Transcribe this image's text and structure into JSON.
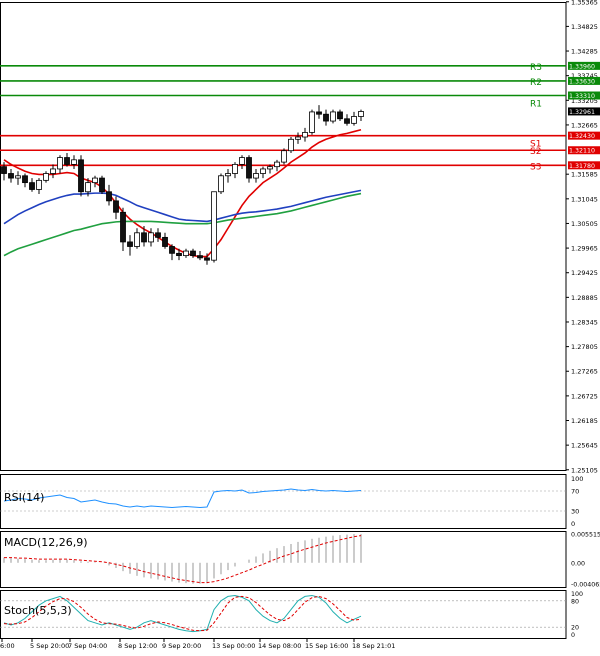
{
  "chart_data": {
    "type": "candlestick",
    "title": "",
    "price_axis": {
      "ylim": [
        1.251,
        1.3536
      ],
      "ticks": [
        "1.35365",
        "1.34825",
        "1.34285",
        "1.33745",
        "1.33205",
        "1.32665",
        "1.31585",
        "1.31045",
        "1.30505",
        "1.29965",
        "1.29425",
        "1.28885",
        "1.28345",
        "1.27805",
        "1.27265",
        "1.26725",
        "1.26185",
        "1.25645",
        "1.25105"
      ]
    },
    "x_axis": {
      "tick_labels": [
        "6:00",
        "5 Sep 20:00",
        "7 Sep 04:00",
        "8 Sep 12:00",
        "9 Sep 20:00",
        "13 Sep 00:00",
        "14 Sep 08:00",
        "15 Sep 16:00",
        "18 Sep 21:01"
      ]
    },
    "current_price": {
      "label": "1.32961",
      "value": 1.32961
    },
    "levels": [
      {
        "name": "R3",
        "value": 1.3396,
        "label": "1.33960",
        "color": "#0a8a0a"
      },
      {
        "name": "R2",
        "value": 1.3363,
        "label": "1.33630",
        "color": "#0a8a0a"
      },
      {
        "name": "R1",
        "value": 1.3331,
        "label": "1.33310",
        "color": "#0a8a0a"
      },
      {
        "name": "S1",
        "value": 1.3243,
        "label": "1.32430",
        "color": "#e00000"
      },
      {
        "name": "S2",
        "value": 1.3211,
        "label": "1.32110",
        "color": "#e00000"
      },
      {
        "name": "S3",
        "value": 1.3178,
        "label": "1.31780",
        "color": "#e00000"
      }
    ],
    "candles": [
      {
        "o": 1.3175,
        "h": 1.3185,
        "l": 1.3145,
        "c": 1.316
      },
      {
        "o": 1.316,
        "h": 1.317,
        "l": 1.314,
        "c": 1.315
      },
      {
        "o": 1.315,
        "h": 1.3165,
        "l": 1.3135,
        "c": 1.3155
      },
      {
        "o": 1.3155,
        "h": 1.316,
        "l": 1.313,
        "c": 1.314
      },
      {
        "o": 1.314,
        "h": 1.315,
        "l": 1.312,
        "c": 1.3125
      },
      {
        "o": 1.3125,
        "h": 1.315,
        "l": 1.3115,
        "c": 1.3145
      },
      {
        "o": 1.3145,
        "h": 1.3165,
        "l": 1.314,
        "c": 1.316
      },
      {
        "o": 1.316,
        "h": 1.318,
        "l": 1.315,
        "c": 1.317
      },
      {
        "o": 1.317,
        "h": 1.32,
        "l": 1.316,
        "c": 1.3195
      },
      {
        "o": 1.3195,
        "h": 1.3205,
        "l": 1.3175,
        "c": 1.318
      },
      {
        "o": 1.318,
        "h": 1.32,
        "l": 1.317,
        "c": 1.319
      },
      {
        "o": 1.319,
        "h": 1.32,
        "l": 1.311,
        "c": 1.312
      },
      {
        "o": 1.312,
        "h": 1.315,
        "l": 1.311,
        "c": 1.314
      },
      {
        "o": 1.314,
        "h": 1.3155,
        "l": 1.313,
        "c": 1.315
      },
      {
        "o": 1.315,
        "h": 1.3155,
        "l": 1.3115,
        "c": 1.312
      },
      {
        "o": 1.312,
        "h": 1.3135,
        "l": 1.309,
        "c": 1.31
      },
      {
        "o": 1.31,
        "h": 1.311,
        "l": 1.306,
        "c": 1.3075
      },
      {
        "o": 1.3075,
        "h": 1.3085,
        "l": 1.299,
        "c": 1.301
      },
      {
        "o": 1.301,
        "h": 1.3025,
        "l": 1.298,
        "c": 1.3
      },
      {
        "o": 1.3,
        "h": 1.304,
        "l": 1.2995,
        "c": 1.303
      },
      {
        "o": 1.303,
        "h": 1.3045,
        "l": 1.3,
        "c": 1.301
      },
      {
        "o": 1.301,
        "h": 1.304,
        "l": 1.3,
        "c": 1.303
      },
      {
        "o": 1.303,
        "h": 1.304,
        "l": 1.301,
        "c": 1.302
      },
      {
        "o": 1.302,
        "h": 1.303,
        "l": 1.2995,
        "c": 1.3
      },
      {
        "o": 1.3,
        "h": 1.3005,
        "l": 1.297,
        "c": 1.2985
      },
      {
        "o": 1.2985,
        "h": 1.2995,
        "l": 1.297,
        "c": 1.298
      },
      {
        "o": 1.298,
        "h": 1.2995,
        "l": 1.2975,
        "c": 1.299
      },
      {
        "o": 1.299,
        "h": 1.2995,
        "l": 1.2975,
        "c": 1.298
      },
      {
        "o": 1.298,
        "h": 1.299,
        "l": 1.297,
        "c": 1.2975
      },
      {
        "o": 1.2975,
        "h": 1.2985,
        "l": 1.296,
        "c": 1.297
      },
      {
        "o": 1.297,
        "h": 1.312,
        "l": 1.2965,
        "c": 1.312
      },
      {
        "o": 1.312,
        "h": 1.316,
        "l": 1.3115,
        "c": 1.3155
      },
      {
        "o": 1.3155,
        "h": 1.317,
        "l": 1.314,
        "c": 1.316
      },
      {
        "o": 1.316,
        "h": 1.3185,
        "l": 1.315,
        "c": 1.318
      },
      {
        "o": 1.318,
        "h": 1.32,
        "l": 1.317,
        "c": 1.3195
      },
      {
        "o": 1.3195,
        "h": 1.32,
        "l": 1.314,
        "c": 1.315
      },
      {
        "o": 1.315,
        "h": 1.317,
        "l": 1.314,
        "c": 1.316
      },
      {
        "o": 1.316,
        "h": 1.3175,
        "l": 1.315,
        "c": 1.317
      },
      {
        "o": 1.317,
        "h": 1.318,
        "l": 1.316,
        "c": 1.3175
      },
      {
        "o": 1.3175,
        "h": 1.319,
        "l": 1.3165,
        "c": 1.3185
      },
      {
        "o": 1.3185,
        "h": 1.3215,
        "l": 1.318,
        "c": 1.321
      },
      {
        "o": 1.321,
        "h": 1.324,
        "l": 1.3205,
        "c": 1.3235
      },
      {
        "o": 1.3235,
        "h": 1.325,
        "l": 1.3225,
        "c": 1.324
      },
      {
        "o": 1.324,
        "h": 1.326,
        "l": 1.323,
        "c": 1.325
      },
      {
        "o": 1.325,
        "h": 1.33,
        "l": 1.3245,
        "c": 1.3295
      },
      {
        "o": 1.3295,
        "h": 1.331,
        "l": 1.328,
        "c": 1.329
      },
      {
        "o": 1.329,
        "h": 1.33,
        "l": 1.3265,
        "c": 1.3275
      },
      {
        "o": 1.3275,
        "h": 1.33,
        "l": 1.327,
        "c": 1.3295
      },
      {
        "o": 1.3295,
        "h": 1.33,
        "l": 1.3275,
        "c": 1.328
      },
      {
        "o": 1.328,
        "h": 1.329,
        "l": 1.3265,
        "c": 1.327
      },
      {
        "o": 1.327,
        "h": 1.3295,
        "l": 1.3265,
        "c": 1.3285
      },
      {
        "o": 1.3285,
        "h": 1.33,
        "l": 1.3275,
        "c": 1.3296
      }
    ],
    "moving_averages": [
      {
        "color": "#e00000",
        "values": [
          1.319,
          1.318,
          1.3172,
          1.3165,
          1.316,
          1.3158,
          1.3158,
          1.3158,
          1.316,
          1.3162,
          1.316,
          1.315,
          1.3145,
          1.314,
          1.313,
          1.3115,
          1.3095,
          1.3075,
          1.306,
          1.3048,
          1.3038,
          1.303,
          1.302,
          1.301,
          1.3,
          1.2992,
          1.2985,
          1.298,
          1.2978,
          1.2978,
          1.2995,
          1.3015,
          1.304,
          1.3065,
          1.309,
          1.311,
          1.3125,
          1.314,
          1.315,
          1.316,
          1.3172,
          1.3185,
          1.3195,
          1.3205,
          1.3218,
          1.3228,
          1.3235,
          1.324,
          1.3245,
          1.3248,
          1.3252,
          1.3256
        ]
      },
      {
        "color": "#2040c0",
        "values": [
          1.305,
          1.306,
          1.307,
          1.3078,
          1.3085,
          1.3092,
          1.3098,
          1.3103,
          1.3108,
          1.3112,
          1.3115,
          1.3115,
          1.3116,
          1.3117,
          1.3117,
          1.3116,
          1.3112,
          1.3105,
          1.3098,
          1.309,
          1.3085,
          1.308,
          1.3075,
          1.307,
          1.3065,
          1.306,
          1.3058,
          1.3057,
          1.3056,
          1.3055,
          1.3058,
          1.3062,
          1.3066,
          1.307,
          1.3073,
          1.3075,
          1.3076,
          1.3078,
          1.308,
          1.3082,
          1.3085,
          1.3088,
          1.3092,
          1.3096,
          1.31,
          1.3104,
          1.3108,
          1.3111,
          1.3114,
          1.3117,
          1.312,
          1.3123
        ]
      },
      {
        "color": "#20a040",
        "values": [
          1.298,
          1.2988,
          1.2995,
          1.3,
          1.3005,
          1.301,
          1.3015,
          1.302,
          1.3025,
          1.303,
          1.3035,
          1.3038,
          1.3042,
          1.3046,
          1.305,
          1.3052,
          1.3054,
          1.3055,
          1.3055,
          1.3055,
          1.3055,
          1.3055,
          1.3054,
          1.3053,
          1.3052,
          1.3051,
          1.305,
          1.305,
          1.305,
          1.305,
          1.3052,
          1.3055,
          1.3058,
          1.306,
          1.3062,
          1.3064,
          1.3066,
          1.3068,
          1.307,
          1.3072,
          1.3075,
          1.3078,
          1.3082,
          1.3086,
          1.309,
          1.3094,
          1.3098,
          1.3102,
          1.3106,
          1.311,
          1.3113,
          1.3116
        ]
      }
    ],
    "rsi": {
      "label": "RSI(14)",
      "ticks": [
        "100",
        "70",
        "30",
        "0"
      ],
      "values": [
        50,
        52,
        55,
        54,
        52,
        56,
        58,
        60,
        62,
        57,
        55,
        48,
        50,
        52,
        48,
        45,
        44,
        40,
        38,
        40,
        38,
        40,
        39,
        38,
        37,
        38,
        39,
        38,
        37,
        38,
        68,
        70,
        71,
        70,
        72,
        66,
        67,
        69,
        70,
        71,
        72,
        74,
        72,
        71,
        73,
        71,
        70,
        71,
        70,
        69,
        70,
        71
      ]
    },
    "macd": {
      "label": "MACD(12,26,9)",
      "ticks": [
        "0.005515",
        "0.00",
        "-0.004065"
      ],
      "histogram": [
        0.001,
        0.0009,
        0.0008,
        0.0007,
        0.0006,
        0.0005,
        0.0005,
        0.0006,
        0.0006,
        0.0006,
        0.0005,
        0.0003,
        0.0002,
        0.0001,
        0.0,
        -0.0005,
        -0.001,
        -0.0016,
        -0.0021,
        -0.0025,
        -0.0028,
        -0.003,
        -0.0032,
        -0.0034,
        -0.0036,
        -0.0038,
        -0.0039,
        -0.004,
        -0.004,
        -0.0039,
        -0.003,
        -0.0022,
        -0.0014,
        -0.0007,
        0.0,
        0.0006,
        0.0012,
        0.0018,
        0.0023,
        0.0028,
        0.0032,
        0.0036,
        0.004,
        0.0043,
        0.0046,
        0.0048,
        0.005,
        0.0052,
        0.0053,
        0.0054,
        0.0055,
        0.0055
      ],
      "signal": [
        0.001,
        0.001,
        0.0009,
        0.0009,
        0.0008,
        0.0007,
        0.0007,
        0.0007,
        0.0007,
        0.0007,
        0.0006,
        0.0005,
        0.0004,
        0.0003,
        0.0002,
        0.0,
        -0.0003,
        -0.0006,
        -0.001,
        -0.0013,
        -0.0017,
        -0.002,
        -0.0023,
        -0.0026,
        -0.0029,
        -0.0032,
        -0.0034,
        -0.0036,
        -0.0038,
        -0.0038,
        -0.0036,
        -0.0033,
        -0.0029,
        -0.0024,
        -0.0019,
        -0.0014,
        -0.0008,
        -0.0003,
        0.0003,
        0.0008,
        0.0013,
        0.0017,
        0.0022,
        0.0026,
        0.003,
        0.0034,
        0.0038,
        0.0041,
        0.0044,
        0.0047,
        0.005,
        0.0052
      ]
    },
    "stoch": {
      "label": "Stoch(5,5,3)",
      "ticks": [
        "100",
        "80",
        "20",
        "0"
      ],
      "main": [
        30,
        25,
        30,
        40,
        55,
        70,
        80,
        85,
        90,
        80,
        65,
        50,
        35,
        30,
        25,
        30,
        25,
        20,
        15,
        20,
        30,
        35,
        30,
        25,
        20,
        15,
        12,
        10,
        12,
        15,
        60,
        80,
        90,
        92,
        88,
        80,
        60,
        45,
        35,
        30,
        40,
        60,
        80,
        90,
        92,
        88,
        75,
        55,
        40,
        30,
        38,
        45
      ],
      "signal": [
        28,
        27,
        28,
        32,
        42,
        55,
        68,
        78,
        85,
        85,
        78,
        65,
        50,
        38,
        30,
        28,
        27,
        24,
        20,
        18,
        22,
        28,
        32,
        30,
        26,
        21,
        17,
        13,
        12,
        13,
        30,
        52,
        75,
        88,
        90,
        87,
        76,
        62,
        48,
        38,
        35,
        43,
        60,
        77,
        87,
        90,
        85,
        73,
        58,
        42,
        36,
        38
      ]
    }
  }
}
